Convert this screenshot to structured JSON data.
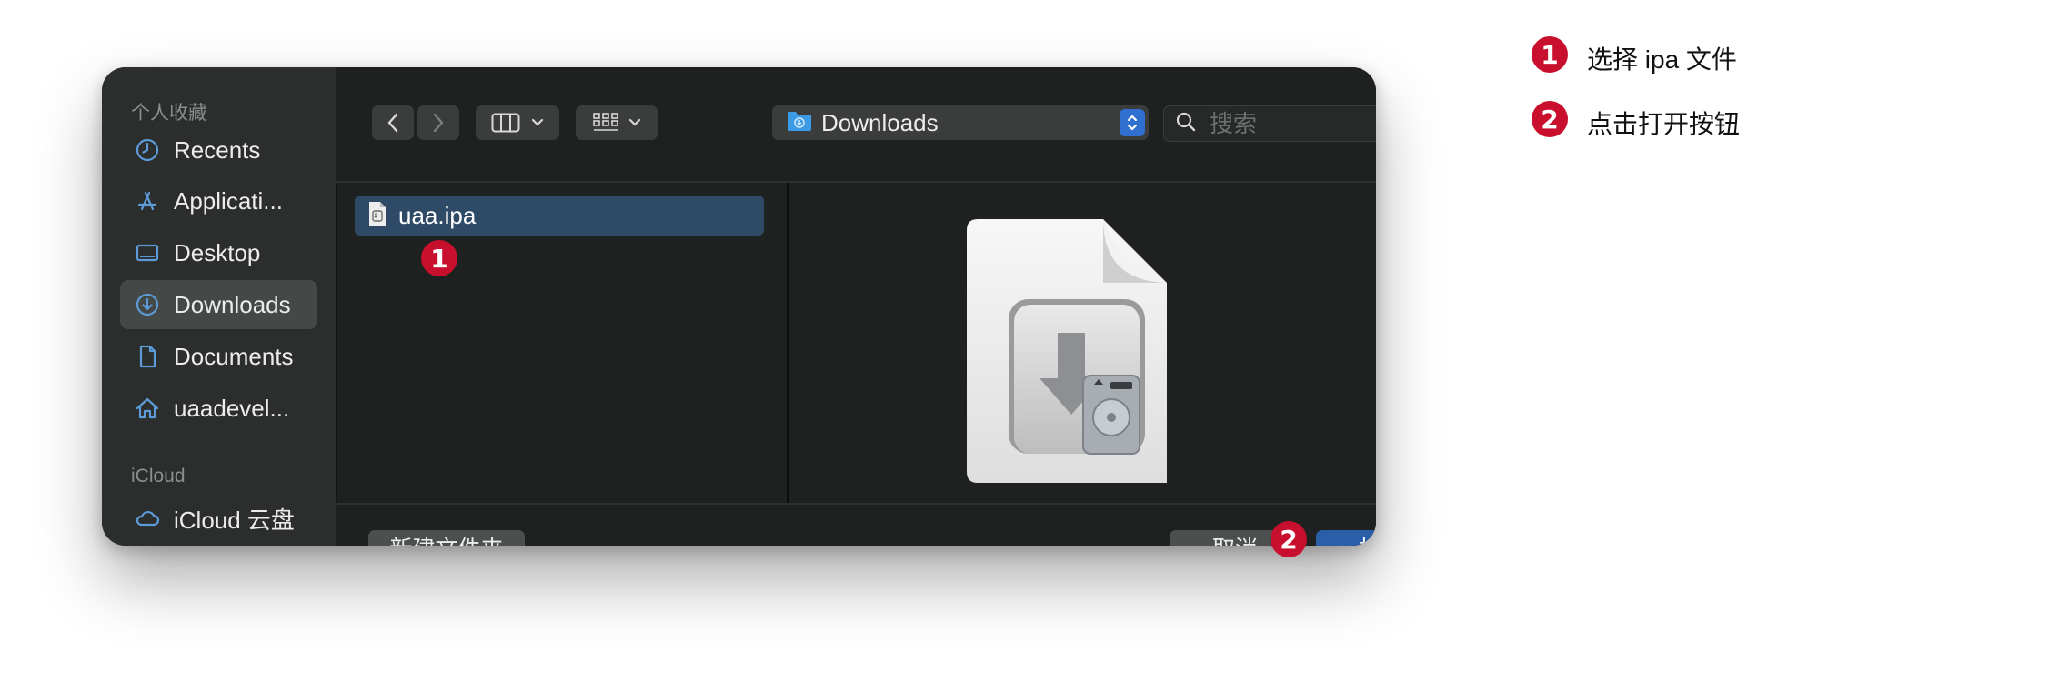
{
  "sidebar": {
    "favorites_header": "个人收藏",
    "icloud_header": "iCloud",
    "items": [
      {
        "label": "Recents",
        "icon": "clock-icon"
      },
      {
        "label": "Applicati...",
        "icon": "applications-icon"
      },
      {
        "label": "Desktop",
        "icon": "desktop-icon"
      },
      {
        "label": "Downloads",
        "icon": "downloads-icon"
      },
      {
        "label": "Documents",
        "icon": "document-icon"
      },
      {
        "label": "uaadevel...",
        "icon": "home-icon"
      }
    ],
    "icloud_items": [
      {
        "label": "iCloud 云盘",
        "icon": "cloud-icon"
      }
    ],
    "selected": "Downloads"
  },
  "toolbar": {
    "path_label": "Downloads",
    "search_placeholder": "搜索"
  },
  "browser": {
    "files": [
      {
        "name": "uaa.ipa",
        "icon": "ipa-file-icon",
        "selected": true
      }
    ]
  },
  "footer": {
    "new_folder": "新建文件夹",
    "cancel": "取消",
    "open": "打开"
  },
  "annotations": {
    "steps": [
      {
        "number": "1",
        "text": "选择 ipa 文件"
      },
      {
        "number": "2",
        "text": "点击打开按钮"
      }
    ]
  },
  "colors": {
    "badge": "#c8102e",
    "primary_button": "#2a5ea8",
    "selection": "#2f4a66"
  }
}
